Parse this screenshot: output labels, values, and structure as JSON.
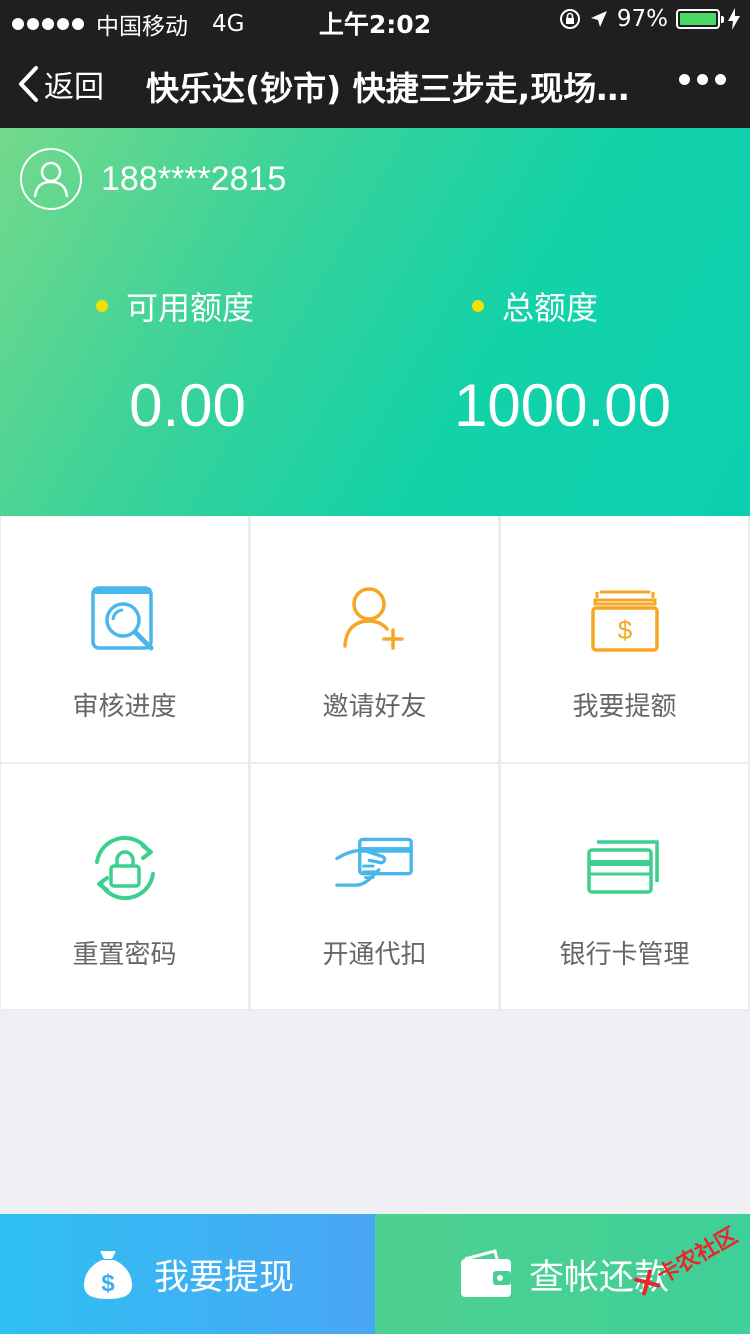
{
  "status_bar": {
    "carrier": "中国移动",
    "network": "4G",
    "time": "上午2:02",
    "battery_percent": "97%"
  },
  "nav": {
    "back_label": "返回",
    "title": "快乐达(钞市) 快捷三步走,现场审核"
  },
  "account": {
    "phone": "188****2815"
  },
  "credit": {
    "available_label": "可用额度",
    "available_value": "0.00",
    "total_label": "总额度",
    "total_value": "1000.00"
  },
  "menu": [
    {
      "label": "审核进度",
      "icon": "search-document-icon"
    },
    {
      "label": "邀请好友",
      "icon": "add-user-icon"
    },
    {
      "label": "我要提额",
      "icon": "money-stack-icon"
    },
    {
      "label": "重置密码",
      "icon": "lock-refresh-icon"
    },
    {
      "label": "开通代扣",
      "icon": "hand-card-icon"
    },
    {
      "label": "银行卡管理",
      "icon": "bank-cards-icon"
    }
  ],
  "bottom": {
    "withdraw_label": "我要提现",
    "repay_label": "查帐还款"
  },
  "watermark": {
    "text": "卡农社区"
  },
  "colors": {
    "header_start": "#74d98b",
    "header_end": "#0ccfb0",
    "dot_yellow": "#f4e000",
    "blue": "#4aa6f5",
    "orange": "#f5a623",
    "green": "#3ccf8e",
    "card_blue": "#48b8ec"
  }
}
